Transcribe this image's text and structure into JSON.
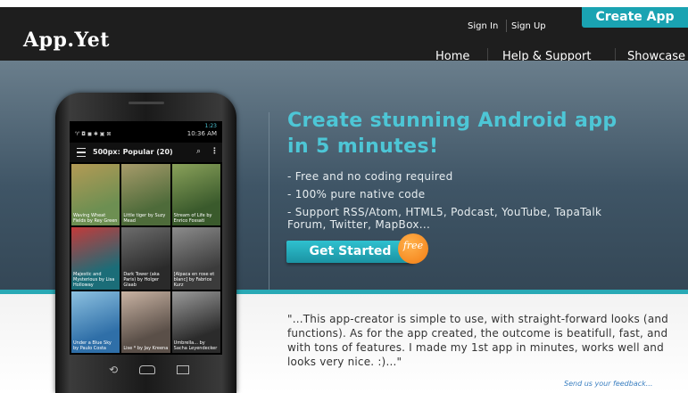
{
  "header": {
    "logo": "App.Yet",
    "sign_in": "Sign In",
    "sign_up": "Sign Up",
    "create_app": "Create App",
    "nav": {
      "home": "Home",
      "help": "Help & Support",
      "showcase": "Showcase"
    }
  },
  "hero": {
    "title_line1": "Create stunning Android app",
    "title_line2": "in 5 minutes!",
    "features": [
      "- Free and no coding required",
      "- 100% pure native code",
      "- Support RSS/Atom, HTML5, Podcast, YouTube, TapaTalk",
      "Forum, Twitter, MapBox..."
    ],
    "cta_label": "Get Started",
    "cta_badge": "free"
  },
  "phone": {
    "status_icons": "♈ ◘ ◼ ✱ ▣ ⊠",
    "status_time": "10:36 AM",
    "status_top": "1:23",
    "action_title": "500px: Popular (20)",
    "search_icon": "search-icon",
    "tiles": [
      {
        "label": "Waving Wheat Fields by Rey Green",
        "color1": "#6d8f52",
        "color2": "#b39a55"
      },
      {
        "label": "Little tiger by Suzy Mead",
        "color1": "#4e6b3a",
        "color2": "#a79b6a"
      },
      {
        "label": "Stream of Life by Enrico Fossati",
        "color1": "#3a5a2c",
        "color2": "#8aa15a"
      },
      {
        "label": "Majestic and Mysterious by Lisa Holloway",
        "color1": "#1b6d78",
        "color2": "#c33a3a"
      },
      {
        "label": "Dark Tower (aka Paris) by Holger Glaab",
        "color1": "#2a2a2a",
        "color2": "#6d6d6d"
      },
      {
        "label": "[Alpaca en rose et blanc] by Fabrice Kurz",
        "color1": "#3b3b3b",
        "color2": "#8c8c8c"
      },
      {
        "label": "Under a Blue Sky by Paulo Costa",
        "color1": "#2f6fa8",
        "color2": "#8dc1e0"
      },
      {
        "label": "Lise * by Jay Kreena",
        "color1": "#5a4f48",
        "color2": "#c9b3a3"
      },
      {
        "label": "Umbrella... by Sacha Leyendecker",
        "color1": "#2b2b2b",
        "color2": "#9a9a9a"
      }
    ]
  },
  "testimonial": {
    "quote": "\"...This app-creator is simple to use, with straight-forward looks (and functions). As for the app created, the outcome is beatifull, fast, and with tons of features. I made my 1st app in minutes, works well and looks very nice. :)...\"",
    "feedback_link": "Send us your feedback..."
  }
}
